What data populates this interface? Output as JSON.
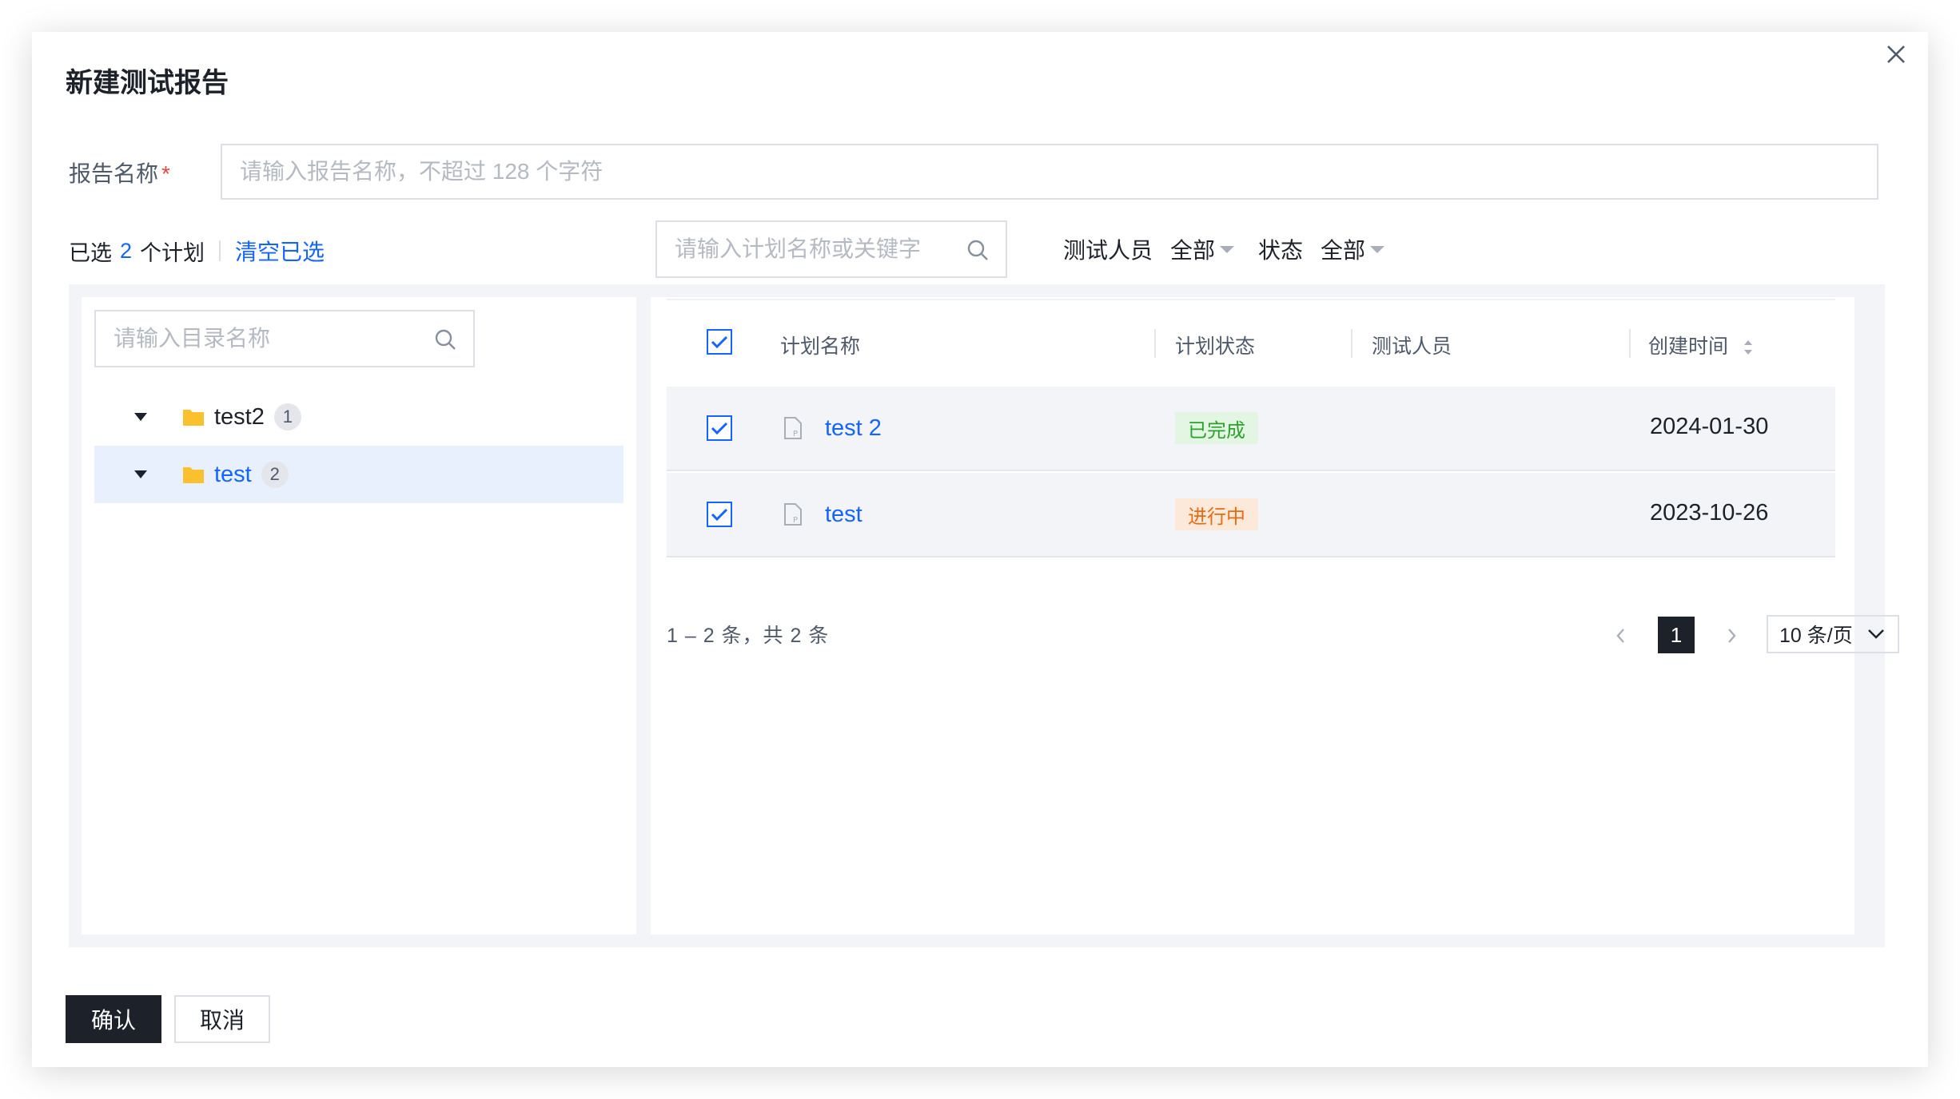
{
  "dialog": {
    "title": "新建测试报告",
    "close_icon": "close-icon"
  },
  "form": {
    "name_label": "报告名称",
    "required_mark": "*",
    "name_placeholder": "请输入报告名称，不超过 128 个字符",
    "name_value": ""
  },
  "selection": {
    "prefix": "已选",
    "count": "2",
    "suffix": "个计划",
    "clear_label": "清空已选"
  },
  "plan_search": {
    "placeholder": "请输入计划名称或关键字",
    "icon": "search-icon"
  },
  "filters": {
    "tester_label": "测试人员",
    "tester_value": "全部",
    "status_label": "状态",
    "status_value": "全部"
  },
  "tree": {
    "search_placeholder": "请输入目录名称",
    "nodes": [
      {
        "label": "test2",
        "count": "1",
        "icon": "folder-icon",
        "active": false
      },
      {
        "label": "test",
        "count": "2",
        "icon": "folder-icon",
        "active": true
      }
    ]
  },
  "table": {
    "columns": [
      "计划名称",
      "计划状态",
      "测试人员",
      "创建时间"
    ],
    "rows": [
      {
        "checked": true,
        "name": "test 2",
        "status": "已完成",
        "status_type": "done",
        "tester": "",
        "created": "2024-01-30"
      },
      {
        "checked": true,
        "name": "test",
        "status": "进行中",
        "status_type": "doing",
        "tester": "",
        "created": "2023-10-26"
      }
    ]
  },
  "pagination": {
    "total_text": "1 – 2 条，共 2 条",
    "current_page": "1",
    "page_size": "10 条/页"
  },
  "footer": {
    "confirm_label": "确认",
    "cancel_label": "取消"
  },
  "colors": {
    "primary": "#1664ff",
    "dark_button": "#1d2129",
    "folder": "#fbc02d",
    "done_text": "#2ba32b",
    "doing_text": "#e86a12"
  }
}
